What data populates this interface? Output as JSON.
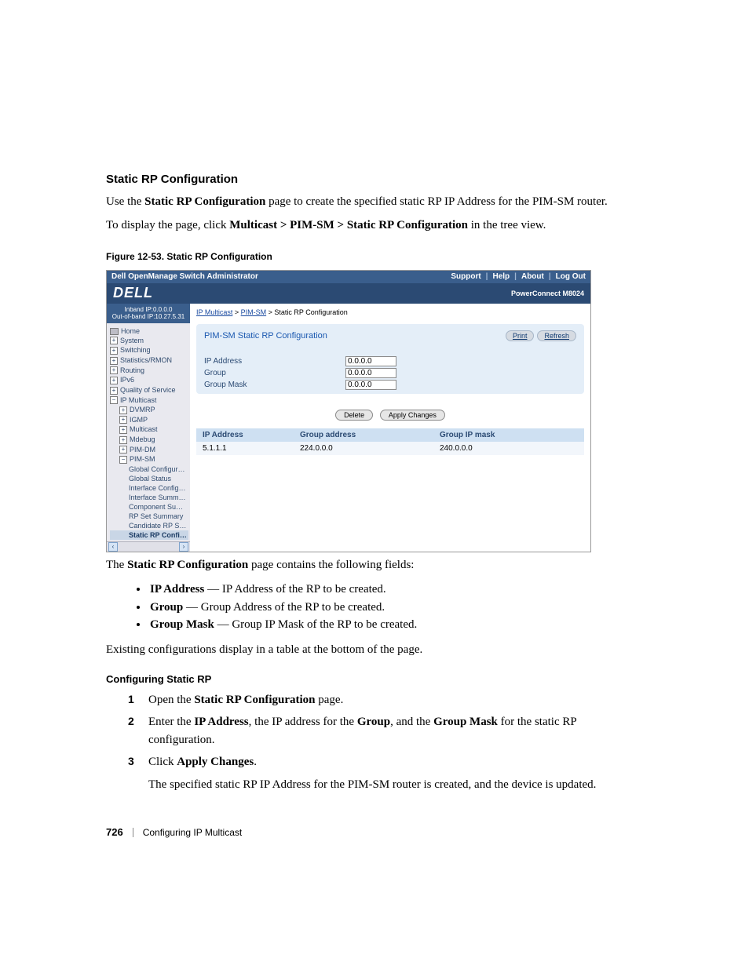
{
  "doc": {
    "heading": "Static RP Configuration",
    "intro_pre": "Use the ",
    "intro_bold": "Static RP Configuration",
    "intro_post": " page to create the specified static RP IP Address for the PIM-SM router.",
    "nav_pre": "To display the page, click ",
    "nav_bold": "Multicast > PIM-SM > Static RP Configuration",
    "nav_post": " in the tree view.",
    "figure_caption": "Figure 12-53.    Static RP Configuration",
    "after_fig_pre": "The ",
    "after_fig_bold": "Static RP Configuration",
    "after_fig_post": " page contains the following fields:",
    "fields": [
      {
        "name": "IP Address",
        "desc": " — IP Address of the RP to be created."
      },
      {
        "name": "Group",
        "desc": " — Group Address of the RP to be created."
      },
      {
        "name": "Group Mask",
        "desc": " — Group IP Mask of the RP to be created."
      }
    ],
    "existing_line": "Existing configurations display in a table at the bottom of the page.",
    "sub_heading": "Configuring Static RP",
    "steps": {
      "s1_pre": "Open the ",
      "s1_bold": "Static RP Configuration",
      "s1_post": " page.",
      "s2_pre": "Enter the ",
      "s2_b1": "IP Address",
      "s2_mid1": ", the IP address for the ",
      "s2_b2": "Group",
      "s2_mid2": ", and the ",
      "s2_b3": "Group Mask",
      "s2_post": " for the static RP configuration.",
      "s3_pre": "Click ",
      "s3_bold": "Apply Changes",
      "s3_post": ".",
      "s3_result": "The specified static RP IP Address for the PIM-SM router is created, and the device is updated."
    },
    "footer": {
      "page": "726",
      "chapter": "Configuring IP Multicast"
    }
  },
  "ss": {
    "topbar": {
      "title": "Dell OpenManage Switch Administrator",
      "links": [
        "Support",
        "Help",
        "About",
        "Log Out"
      ]
    },
    "logo": "DELL",
    "model": "PowerConnect M8024",
    "ip_inband": "Inband IP:0.0.0.0",
    "ip_oob": "Out-of-band IP:10.27.5.31",
    "tree": {
      "home": "Home",
      "items_top": [
        "System",
        "Switching",
        "Statistics/RMON",
        "Routing",
        "IPv6",
        "Quality of Service"
      ],
      "ipmulticast": "IP Multicast",
      "ipm_children": [
        "DVMRP",
        "IGMP",
        "Multicast",
        "Mdebug",
        "PIM-DM"
      ],
      "pimsm": "PIM-SM",
      "pimsm_children": [
        "Global Configuration",
        "Global Status",
        "Interface Configuration",
        "Interface Summary",
        "Component Summary",
        "RP Set Summary",
        "Candidate RP Summ"
      ],
      "active": "Static RP Configura"
    },
    "breadcrumb": {
      "a": "IP Multicast",
      "b": "PIM-SM",
      "c": "Static RP Configuration"
    },
    "panel": {
      "title": "PIM-SM Static RP Configuration",
      "print": "Print",
      "refresh": "Refresh",
      "rows": [
        {
          "label": "IP Address",
          "value": "0.0.0.0"
        },
        {
          "label": "Group",
          "value": "0.0.0.0"
        },
        {
          "label": "Group Mask",
          "value": "0.0.0.0"
        }
      ]
    },
    "buttons": {
      "delete": "Delete",
      "apply": "Apply Changes"
    },
    "table": {
      "headers": [
        "IP Address",
        "Group address",
        "Group IP mask"
      ],
      "row": [
        "5.1.1.1",
        "224.0.0.0",
        "240.0.0.0"
      ]
    }
  }
}
